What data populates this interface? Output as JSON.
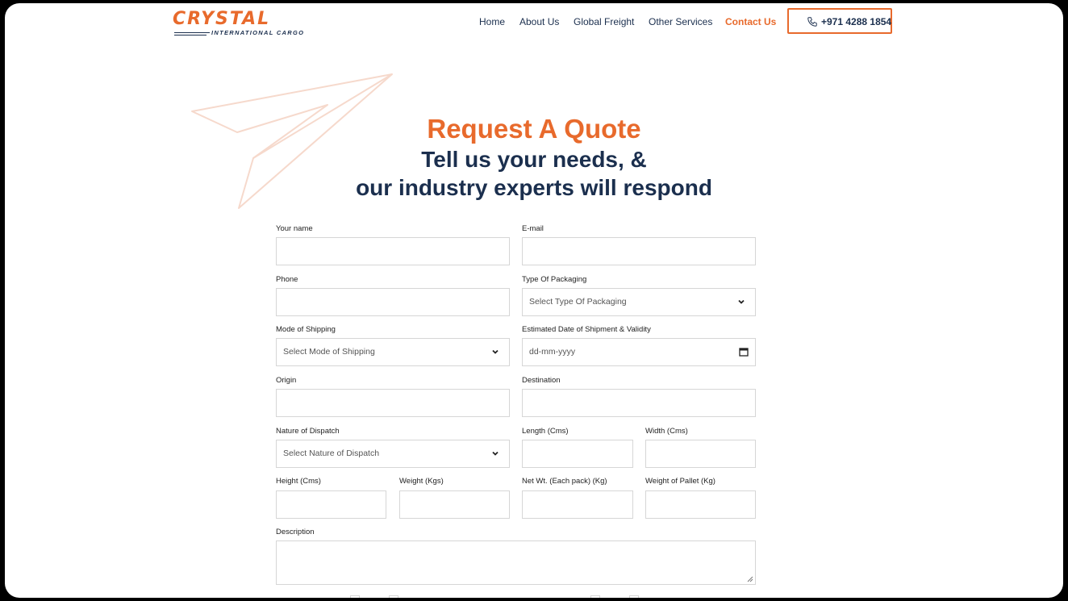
{
  "header": {
    "logo_word": "CRYSTAL",
    "logo_sub": "INTERNATIONAL CARGO",
    "nav": [
      {
        "label": "Home"
      },
      {
        "label": "About Us"
      },
      {
        "label": "Global Freight"
      },
      {
        "label": "Other Services"
      },
      {
        "label": "Contact Us",
        "active": true
      }
    ],
    "phone": "+971 4288 1854"
  },
  "hero": {
    "title": "Request A Quote",
    "subtitle_line1": "Tell us your needs, &",
    "subtitle_line2": "our industry experts will respond"
  },
  "form": {
    "name_label": "Your name",
    "email_label": "E-mail",
    "phone_label": "Phone",
    "packaging_label": "Type Of Packaging",
    "packaging_placeholder": "Select Type Of Packaging",
    "mode_label": "Mode of Shipping",
    "mode_placeholder": "Select Mode of Shipping",
    "date_label": "Estimated Date of Shipment & Validity",
    "date_placeholder": "dd-mm-yyyy",
    "origin_label": "Origin",
    "destination_label": "Destination",
    "dispatch_label": "Nature of Dispatch",
    "dispatch_placeholder": "Select Nature of Dispatch",
    "length_label": "Length (Cms)",
    "width_label": "Width (Cms)",
    "height_label": "Height (Cms)",
    "weight_label": "Weight (Kgs)",
    "netwt_label": "Net Wt. (Each pack) (Kg)",
    "pallet_label": "Weight of Pallet (Kg)",
    "description_label": "Description"
  },
  "colors": {
    "accent": "#e86a2c",
    "navy": "#1b2f4e"
  },
  "icons": [
    "phone-icon",
    "chevron-down-icon",
    "calendar-icon",
    "paper-plane-icon",
    "resize-grip-icon"
  ]
}
